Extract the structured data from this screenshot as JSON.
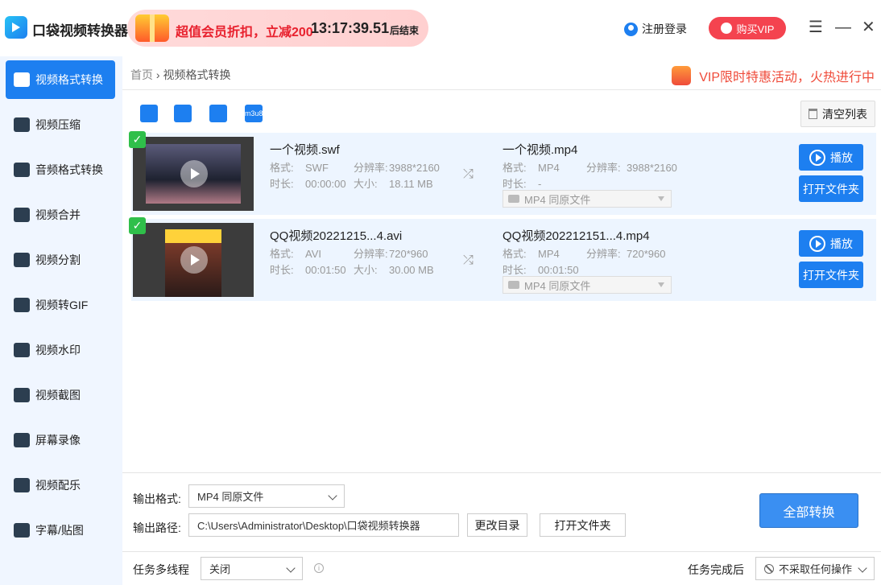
{
  "app": {
    "title": "口袋视频转换器"
  },
  "promo": {
    "text": "超值会员折扣，立减200",
    "countdown": "13:17:39.51",
    "suffix": "后结束"
  },
  "header": {
    "login": "注册登录",
    "vip": "购买VIP",
    "vip_activity": "VIP限时特惠活动，火热进行中"
  },
  "breadcrumb": {
    "home": "首页",
    "sep": "›",
    "current": "视频格式转换"
  },
  "sidebar": {
    "items": [
      {
        "label": "视频格式转换",
        "icon": "convert-icon"
      },
      {
        "label": "视频压缩",
        "icon": "compress-icon"
      },
      {
        "label": "音频格式转换",
        "icon": "audio-icon"
      },
      {
        "label": "视频合并",
        "icon": "merge-icon"
      },
      {
        "label": "视频分割",
        "icon": "split-icon"
      },
      {
        "label": "视频转GIF",
        "icon": "gif-icon"
      },
      {
        "label": "视频水印",
        "icon": "watermark-icon"
      },
      {
        "label": "视频截图",
        "icon": "screenshot-icon"
      },
      {
        "label": "屏幕录像",
        "icon": "record-icon"
      },
      {
        "label": "视频配乐",
        "icon": "music-icon"
      },
      {
        "label": "字幕/贴图",
        "icon": "subtitle-icon"
      }
    ]
  },
  "toolbar": {
    "m3u8": "m3u8",
    "clear": "清空列表"
  },
  "labels": {
    "format": "格式:",
    "resolution": "分辨率:",
    "duration": "时长:",
    "size": "大小:"
  },
  "files": [
    {
      "src_name": "一个视频.swf",
      "src_format": "SWF",
      "src_res": "3988*2160",
      "src_duration": "00:00:00",
      "src_size": "18.11 MB",
      "dst_name": "一个视频.mp4",
      "dst_format": "MP4",
      "dst_res": "3988*2160",
      "dst_duration": "-",
      "dst_select": "MP4   同原文件",
      "play": "播放",
      "open": "打开文件夹"
    },
    {
      "src_name": "QQ视频20221215...4.avi",
      "src_format": "AVI",
      "src_res": "720*960",
      "src_duration": "00:01:50",
      "src_size": "30.00 MB",
      "dst_name": "QQ视频202212151...4.mp4",
      "dst_format": "MP4",
      "dst_res": "720*960",
      "dst_duration": "00:01:50",
      "dst_select": "MP4   同原文件",
      "play": "播放",
      "open": "打开文件夹"
    }
  ],
  "output": {
    "format_label": "输出格式:",
    "format_value": "MP4   同原文件",
    "path_label": "输出路径:",
    "path_value": "C:\\Users\\Administrator\\Desktop\\口袋视频转换器",
    "change_dir": "更改目录",
    "open_folder": "打开文件夹",
    "convert_all": "全部转换"
  },
  "task": {
    "multithread_label": "任务多线程",
    "multithread_value": "关闭",
    "after_label": "任务完成后",
    "after_value": "不采取任何操作"
  },
  "window": {
    "menu": "☰",
    "minimize": "—",
    "close": "✕"
  }
}
